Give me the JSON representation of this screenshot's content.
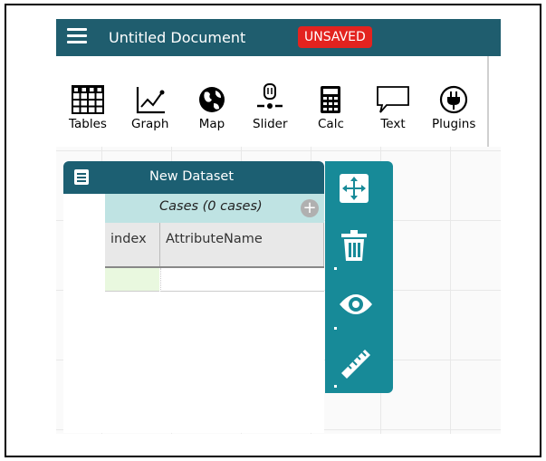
{
  "header": {
    "document_title": "Untitled Document",
    "status_badge": "UNSAVED"
  },
  "toolbar": {
    "tools": [
      {
        "label": "Tables",
        "icon": "table-icon"
      },
      {
        "label": "Graph",
        "icon": "graph-icon"
      },
      {
        "label": "Map",
        "icon": "globe-icon"
      },
      {
        "label": "Slider",
        "icon": "slider-icon"
      },
      {
        "label": "Calc",
        "icon": "calculator-icon"
      },
      {
        "label": "Text",
        "icon": "speech-bubble-icon"
      },
      {
        "label": "Plugins",
        "icon": "plug-icon"
      }
    ]
  },
  "dataset": {
    "title": "New Dataset",
    "cases_label": "Cases (0 cases)",
    "columns": [
      "index",
      "AttributeName"
    ]
  },
  "inspector": {
    "buttons": [
      "move-icon",
      "trash-icon",
      "eye-icon",
      "ruler-icon"
    ]
  },
  "colors": {
    "titlebar": "#1f5d6e",
    "unsaved_badge": "#e3231f",
    "inspector": "#178a98",
    "cases_bar": "#bfe3e3"
  }
}
